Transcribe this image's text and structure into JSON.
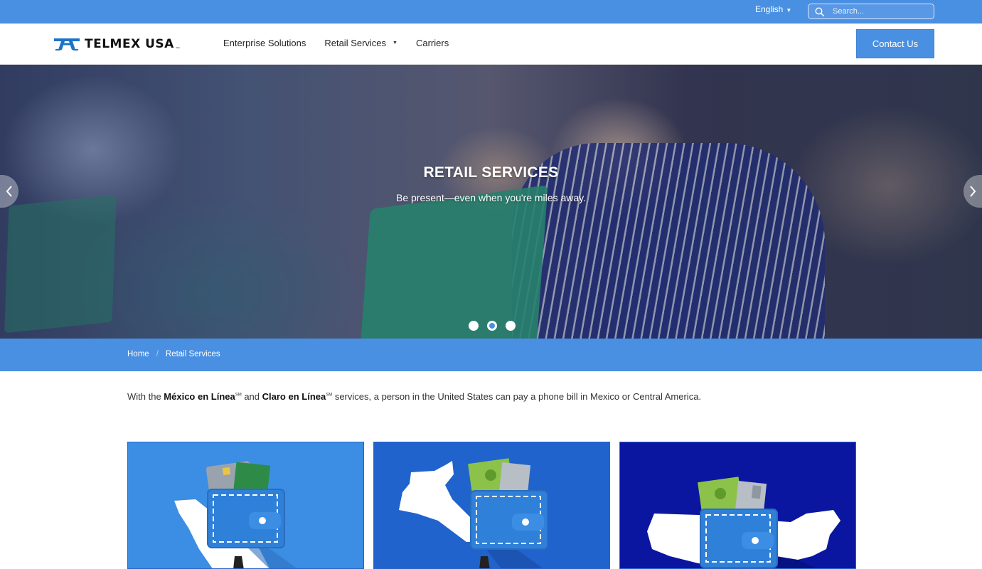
{
  "topbar": {
    "language": "English",
    "search_placeholder": "Search..."
  },
  "header": {
    "logo_text": "TELMEX USA",
    "logo_tm": "™",
    "nav": [
      {
        "label": "Enterprise Solutions",
        "has_dropdown": false
      },
      {
        "label": "Retail Services",
        "has_dropdown": true
      },
      {
        "label": "Carriers",
        "has_dropdown": false
      }
    ],
    "contact_label": "Contact Us"
  },
  "hero": {
    "title": "RETAIL SERVICES",
    "subtitle": "Be present—even when you're miles away.",
    "slides": 3,
    "active_slide": 2
  },
  "breadcrumb": {
    "items": [
      "Home",
      "Retail Services"
    ],
    "separator": "/"
  },
  "intro": {
    "part1": "With the ",
    "brand1": "México en Línea",
    "mark1": "SM",
    "part2": " and ",
    "brand2": "Claro en Línea",
    "mark2": "SM",
    "part3": " services, a person in the United States can pay a phone bill in Mexico or Central America."
  },
  "cards": [
    {
      "name": "mexico",
      "bg": "#3b8ee3"
    },
    {
      "name": "central-america",
      "bg": "#2163cc"
    },
    {
      "name": "united-states",
      "bg": "#0a16a0"
    }
  ],
  "colors": {
    "brand_blue": "#4a90e2",
    "logo_blue": "#1c74c9"
  }
}
